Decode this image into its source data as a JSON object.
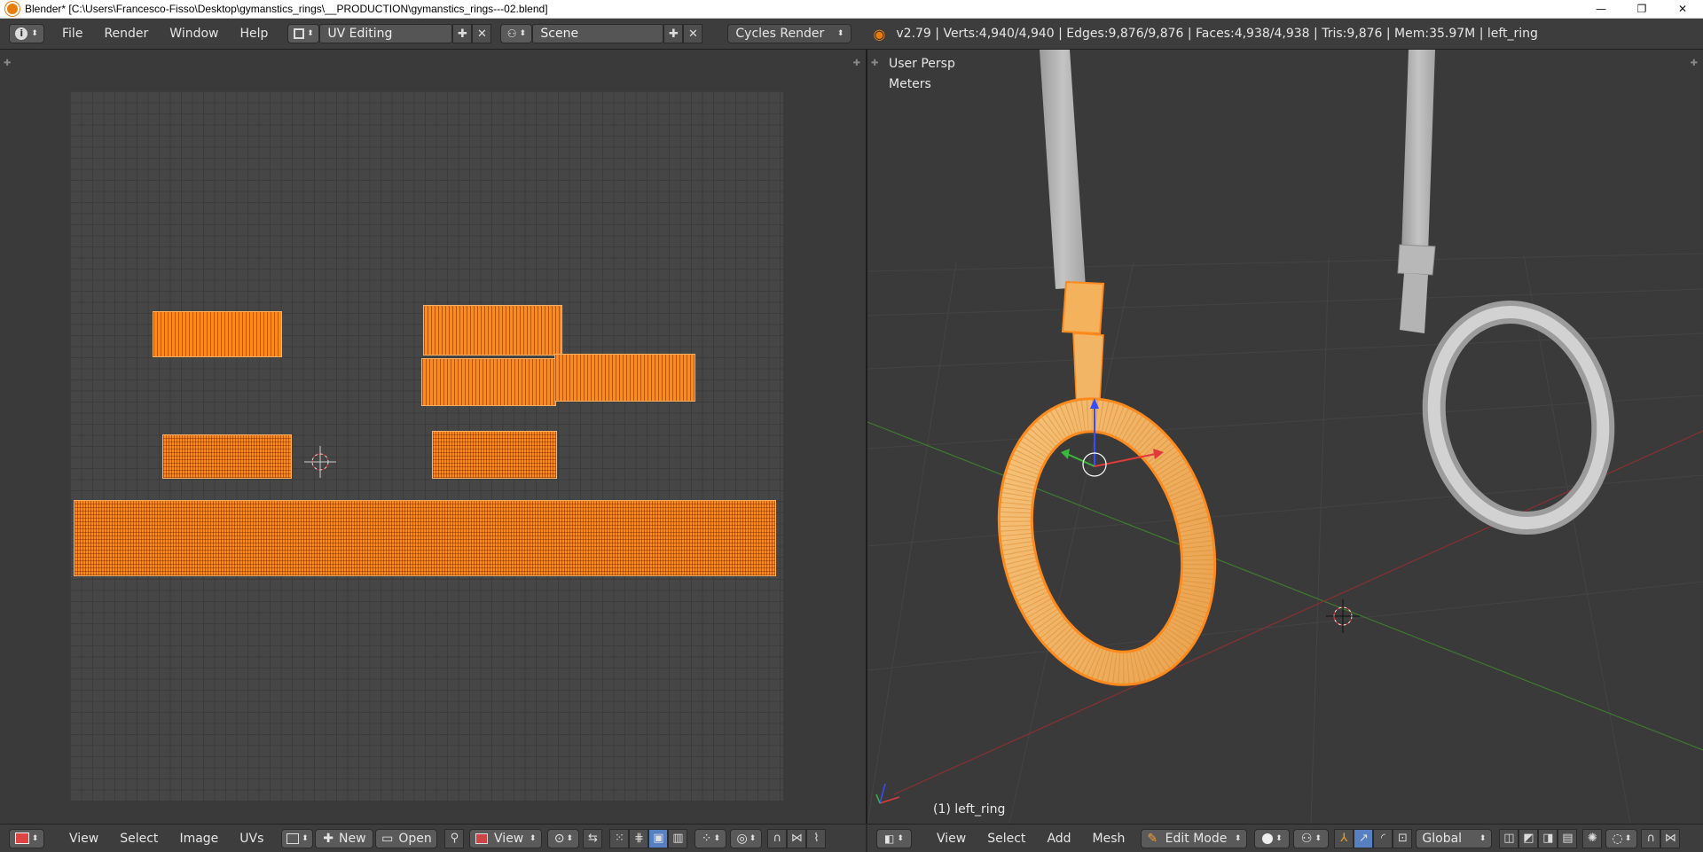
{
  "window": {
    "title": "Blender* [C:\\Users\\Francesco-Fisso\\Desktop\\gymanstics_rings\\__PRODUCTION\\gymanstics_rings---02.blend]",
    "minimize_glyph": "—",
    "maximize_glyph": "❐",
    "close_glyph": "✕"
  },
  "info_header": {
    "menus": [
      "File",
      "Render",
      "Window",
      "Help"
    ],
    "screen_layout": "UV Editing",
    "scene": "Scene",
    "render_engine": "Cycles Render",
    "stats": "v2.79 | Verts:4,940/4,940 | Edges:9,876/9,876 | Faces:4,938/4,938 | Tris:9,876 | Mem:35.97M | left_ring"
  },
  "viewport": {
    "view_name": "User Persp",
    "units": "Meters",
    "object_label": "(1) left_ring"
  },
  "uv_header": {
    "menus": [
      "View",
      "Select",
      "Image",
      "UVs"
    ],
    "new_label": "New",
    "open_label": "Open",
    "view_label": "View"
  },
  "view3d_header": {
    "menus": [
      "View",
      "Select",
      "Add",
      "Mesh"
    ],
    "mode": "Edit Mode",
    "orientation": "Global"
  },
  "colors": {
    "selection": "#ff8a1c",
    "grid": "#464646",
    "background": "#3a3a3a",
    "header": "#3d3d3d"
  },
  "icons": {
    "info": "info-icon",
    "layout": "layout-icon",
    "scene": "scene-icon",
    "blender": "blender-logo-icon"
  }
}
